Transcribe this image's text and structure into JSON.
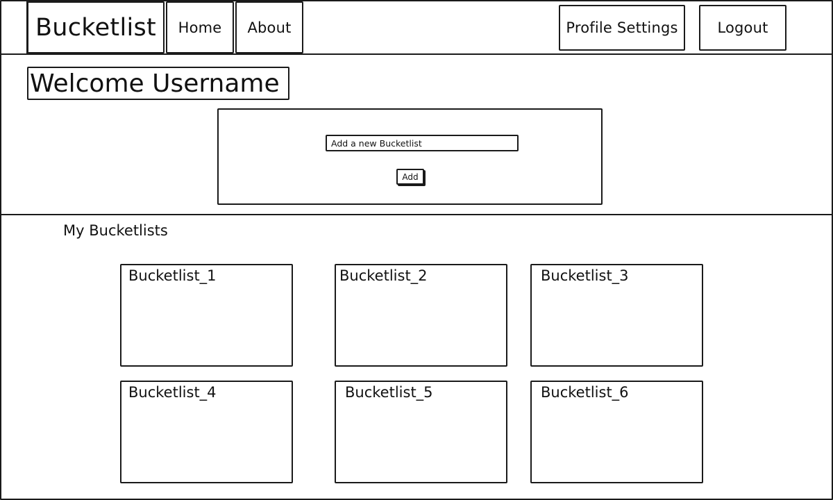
{
  "header": {
    "brand": "Bucketlist",
    "nav": [
      {
        "label": "Home"
      },
      {
        "label": "About"
      }
    ],
    "profile_settings_label": "Profile Settings",
    "logout_label": "Logout"
  },
  "main": {
    "welcome_text": "Welcome Username",
    "add_form": {
      "input_value": "Add a new Bucketlist",
      "button_label": "Add"
    }
  },
  "bucketlists": {
    "heading": "My Bucketlists",
    "items": [
      {
        "title": "Bucketlist_1"
      },
      {
        "title": "Bucketlist_2"
      },
      {
        "title": "Bucketlist_3"
      },
      {
        "title": "Bucketlist_4"
      },
      {
        "title": "Bucketlist_5"
      },
      {
        "title": "Bucketlist_6"
      }
    ]
  }
}
